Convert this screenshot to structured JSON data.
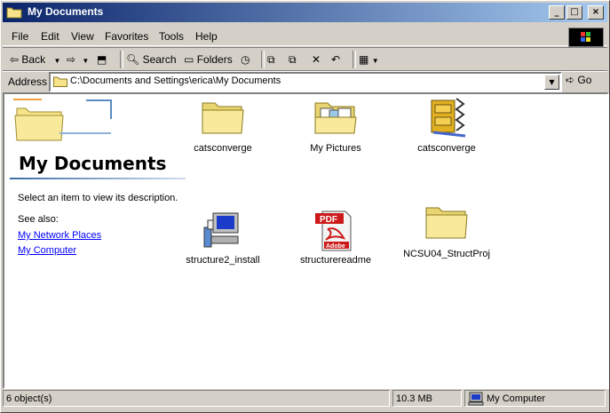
{
  "window": {
    "title": "My Documents",
    "controls": {
      "minimize": "_",
      "maximize": "□",
      "close": "×"
    }
  },
  "menu": [
    "File",
    "Edit",
    "View",
    "Favorites",
    "Tools",
    "Help"
  ],
  "toolbar": {
    "back_label": "Back",
    "search_label": "Search",
    "folders_label": "Folders"
  },
  "address": {
    "label": "Address",
    "value": "C:\\Documents and Settings\\erica\\My Documents",
    "go_label": "Go"
  },
  "left_panel": {
    "title": "My Documents",
    "description": "Select an item to view its description.",
    "see_also": "See also:",
    "links": [
      "My Network Places",
      "My Computer"
    ]
  },
  "items": [
    {
      "label": "catsconverge",
      "icon": "folder-icon"
    },
    {
      "label": "My Pictures",
      "icon": "pictures-folder-icon"
    },
    {
      "label": "catsconverge",
      "icon": "winzip-archive-icon"
    },
    {
      "label": "structure2_install",
      "icon": "installer-icon"
    },
    {
      "label": "structurereadme",
      "icon": "pdf-icon"
    },
    {
      "label": "NCSU04_StructProj",
      "icon": "folder-icon"
    }
  ],
  "status": {
    "objects": "6 object(s)",
    "size": "10.3 MB",
    "zone": "My Computer"
  },
  "colors": {
    "title_start": "#0a246a",
    "title_end": "#a6caf0",
    "link": "#0000ff",
    "folder": "#f6e38a"
  }
}
